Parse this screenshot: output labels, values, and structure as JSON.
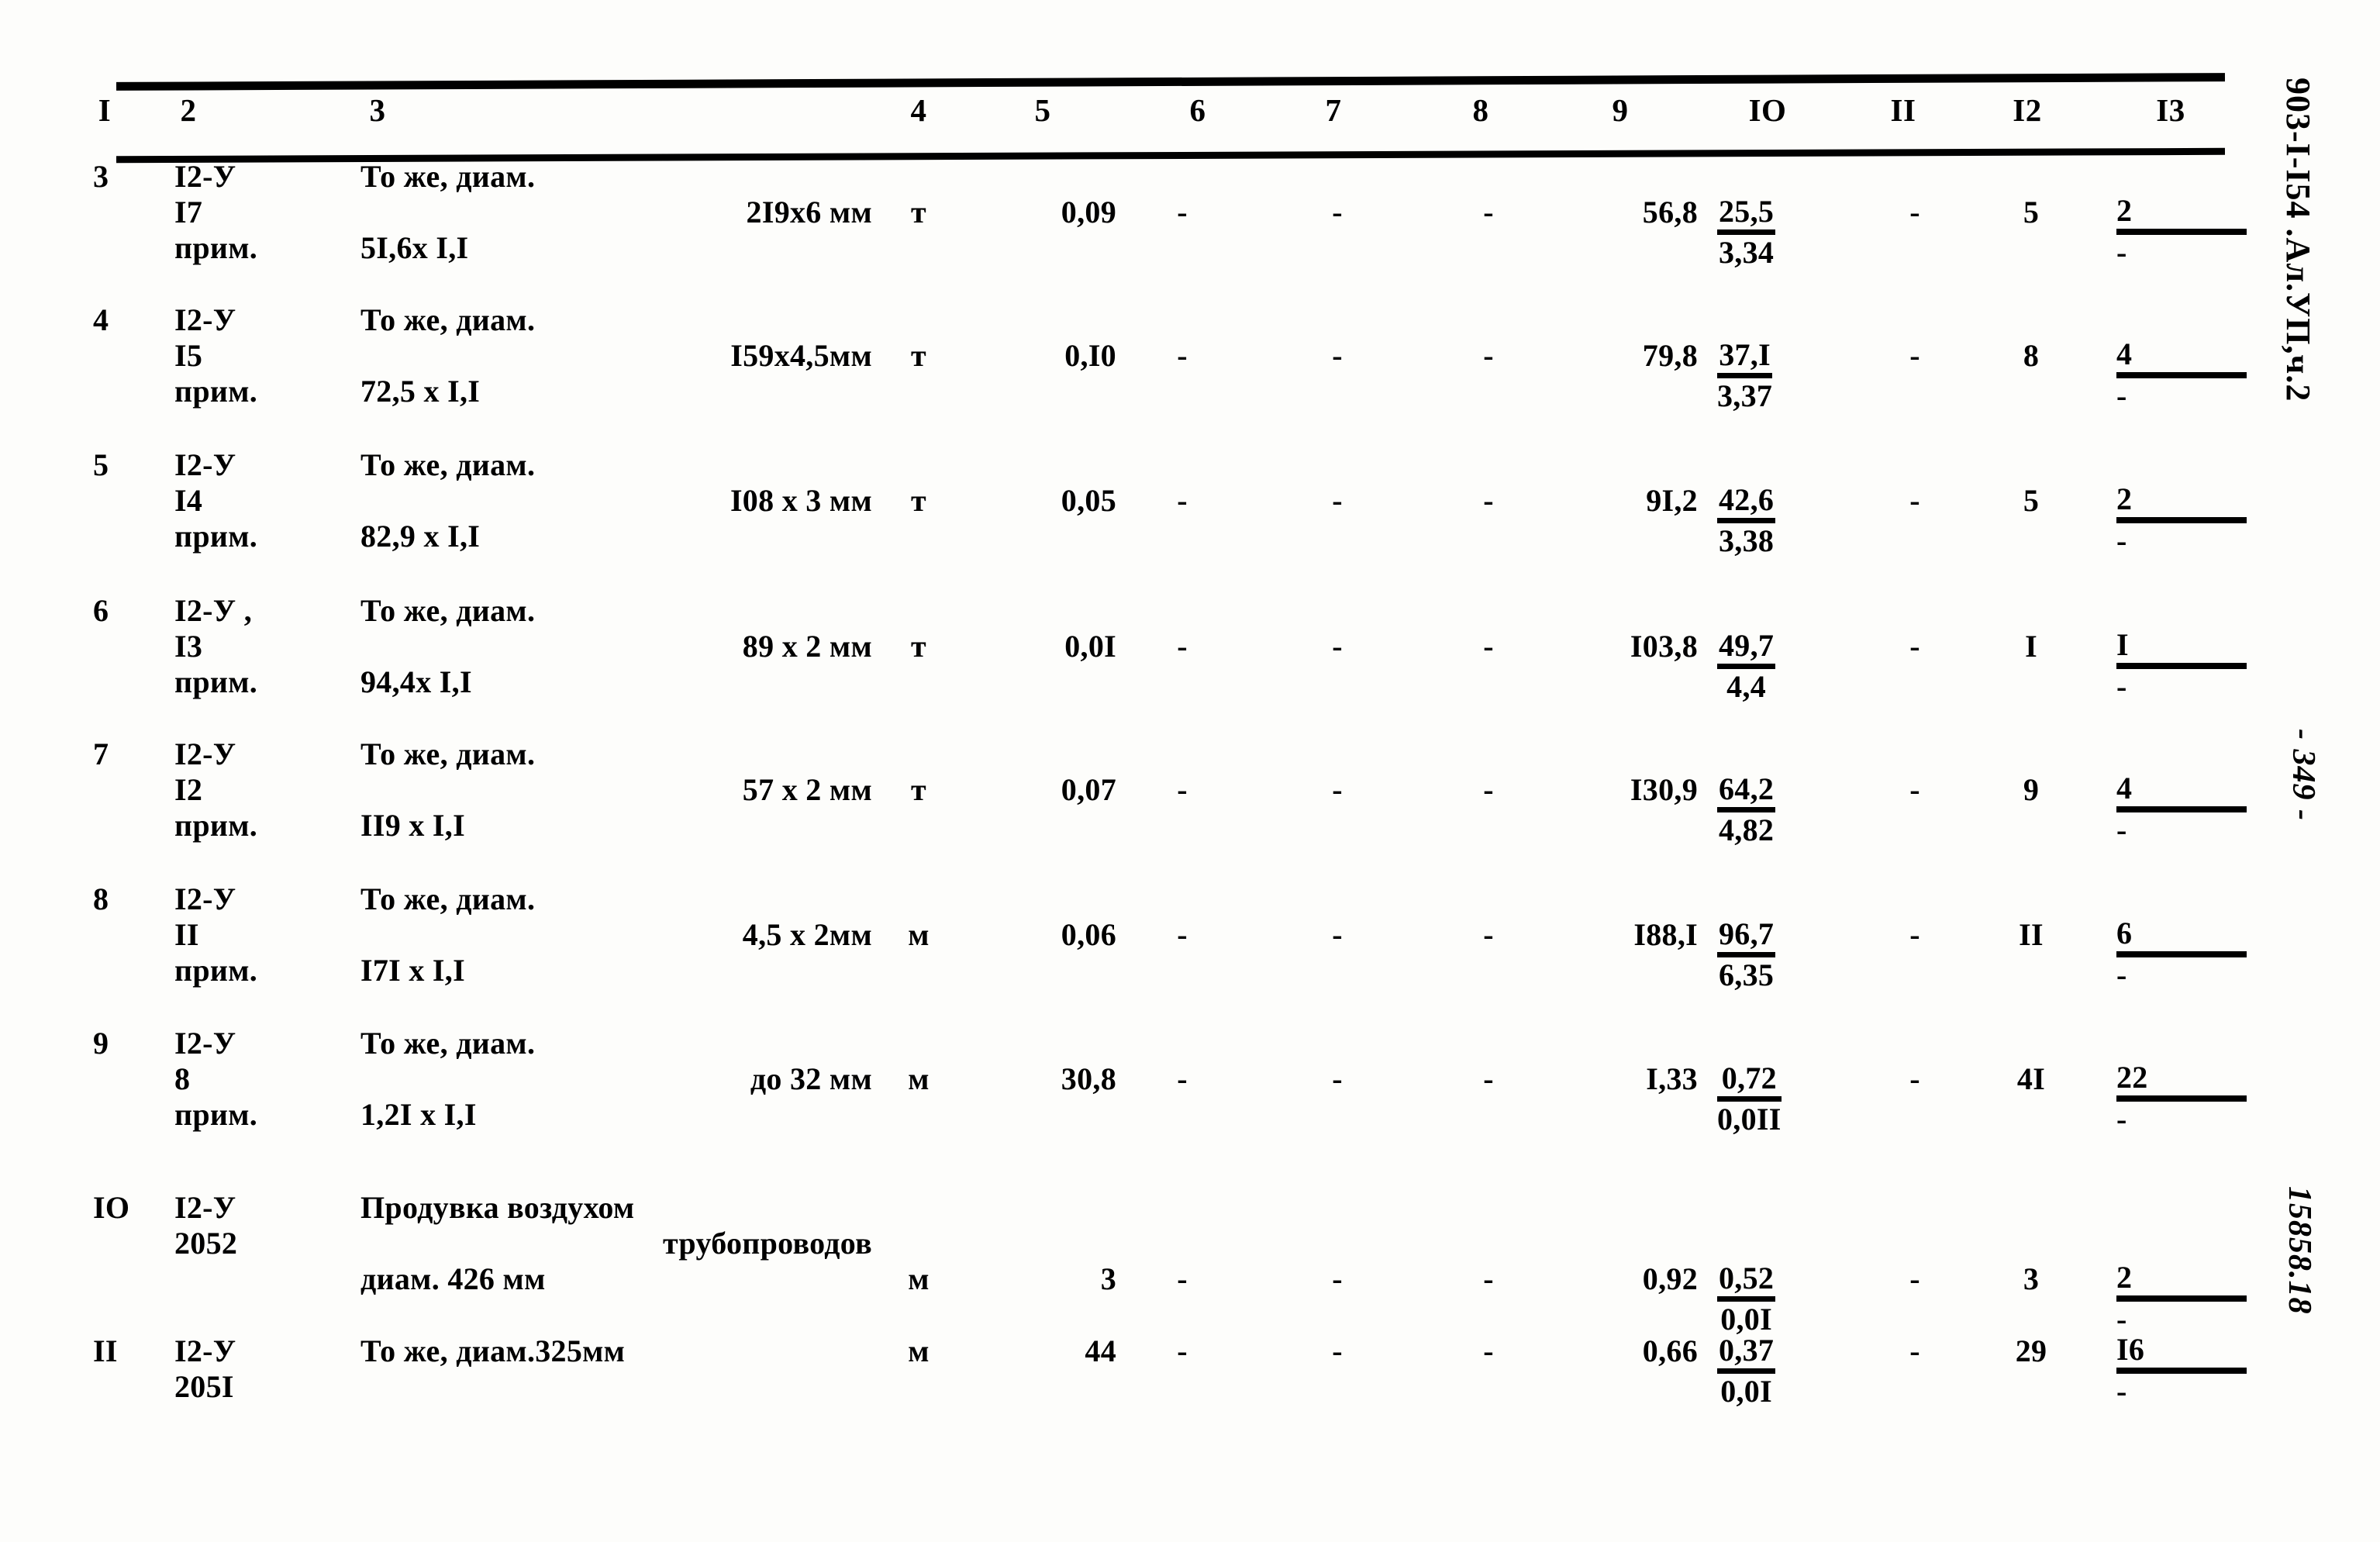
{
  "document": {
    "doc_code": "903-I-I54 .Ал.УП,ч.2",
    "page_marker": "- 349 -",
    "order_number": "15858.18"
  },
  "table": {
    "column_headers": [
      "I",
      "2",
      "3",
      "4",
      "5",
      "6",
      "7",
      "8",
      "9",
      "IO",
      "II",
      "I2",
      "I3"
    ],
    "rows": [
      {
        "no": "3",
        "code_line1": "I2-У",
        "code_line2": "I7",
        "code_line3": "прим.",
        "desc_line1": "То же, диам.",
        "desc_line2": "2I9x6 мм",
        "desc_line3": "5I,6x I,I",
        "unit": "т",
        "qty": "0,09",
        "c6": "-",
        "c7": "-",
        "c8": "-",
        "c9": "56,8",
        "c10_num": "25,5",
        "c10_den": "3,34",
        "c11": "-",
        "c12": "5",
        "c13_num": "2",
        "c13_den": "-"
      },
      {
        "no": "4",
        "code_line1": "I2-У",
        "code_line2": "I5",
        "code_line3": "прим.",
        "desc_line1": "То же, диам.",
        "desc_line2": "I59x4,5мм",
        "desc_line3": "72,5 x I,I",
        "unit": "т",
        "qty": "0,I0",
        "c6": "-",
        "c7": "-",
        "c8": "-",
        "c9": "79,8",
        "c10_num": "37,I",
        "c10_den": "3,37",
        "c11": "-",
        "c12": "8",
        "c13_num": "4",
        "c13_den": "-"
      },
      {
        "no": "5",
        "code_line1": "I2-У",
        "code_line2": "I4",
        "code_line3": "прим.",
        "desc_line1": "То же, диам.",
        "desc_line2": "I08 x 3 мм",
        "desc_line3": "82,9 x I,I",
        "unit": "т",
        "qty": "0,05",
        "c6": "-",
        "c7": "-",
        "c8": "-",
        "c9": "9I,2",
        "c10_num": "42,6",
        "c10_den": "3,38",
        "c11": "-",
        "c12": "5",
        "c13_num": "2",
        "c13_den": "-"
      },
      {
        "no": "6",
        "code_line1": "I2-У ,",
        "code_line2": "I3",
        "code_line3": "прим.",
        "desc_line1": "То же, диам.",
        "desc_line2": "89 x 2 мм",
        "desc_line3": "94,4x I,I",
        "unit": "т",
        "qty": "0,0I",
        "c6": "-",
        "c7": "-",
        "c8": "-",
        "c9": "I03,8",
        "c10_num": "49,7",
        "c10_den": "4,4",
        "c11": "-",
        "c12": "I",
        "c13_num": "I",
        "c13_den": "-"
      },
      {
        "no": "7",
        "code_line1": "I2-У",
        "code_line2": "I2",
        "code_line3": "прим.",
        "desc_line1": "То же, диам.",
        "desc_line2": "57 x 2 мм",
        "desc_line3": "II9 x I,I",
        "unit": "т",
        "qty": "0,07",
        "c6": "-",
        "c7": "-",
        "c8": "-",
        "c9": "I30,9",
        "c10_num": "64,2",
        "c10_den": "4,82",
        "c11": "-",
        "c12": "9",
        "c13_num": "4",
        "c13_den": "-"
      },
      {
        "no": "8",
        "code_line1": "I2-У",
        "code_line2": "II",
        "code_line3": "прим.",
        "desc_line1": "То же, диам.",
        "desc_line2": "4,5 x 2мм",
        "desc_line3": "I7I x I,I",
        "unit": "м",
        "qty": "0,06",
        "c6": "-",
        "c7": "-",
        "c8": "-",
        "c9": "I88,I",
        "c10_num": "96,7",
        "c10_den": "6,35",
        "c11": "-",
        "c12": "II",
        "c13_num": "6",
        "c13_den": "-"
      },
      {
        "no": "9",
        "code_line1": "I2-У",
        "code_line2": "8",
        "code_line3": "прим.",
        "desc_line1": "То же, диам.",
        "desc_line2": "до 32 мм",
        "desc_line3": "1,2I x I,I",
        "unit": "м",
        "qty": "30,8",
        "c6": "-",
        "c7": "-",
        "c8": "-",
        "c9": "I,33",
        "c10_num": "0,72",
        "c10_den": "0,0II",
        "c11": "-",
        "c12": "4I",
        "c13_num": "22",
        "c13_den": "-"
      },
      {
        "no": "IO",
        "code_line1": "I2-У",
        "code_line2": "2052",
        "code_line3": "",
        "desc_line1": "Продувка воздухом",
        "desc_line2": "трубопроводов",
        "desc_line3": "диам. 426 мм",
        "unit": "м",
        "qty": "3",
        "c6": "-",
        "c7": "-",
        "c8": "-",
        "c9": "0,92",
        "c10_num": "0,52",
        "c10_den": "0,0I",
        "c11": "-",
        "c12": "3",
        "c13_num": "2",
        "c13_den": "-"
      },
      {
        "no": "II",
        "code_line1": "I2-У",
        "code_line2": "205I",
        "code_line3": "",
        "desc_line1": "То же, диам.325мм",
        "desc_line2": "",
        "desc_line3": "",
        "unit": "м",
        "qty": "44",
        "c6": "-",
        "c7": "-",
        "c8": "-",
        "c9": "0,66",
        "c10_num": "0,37",
        "c10_den": "0,0I",
        "c11": "-",
        "c12": "29",
        "c13_num": "I6",
        "c13_den": "-"
      }
    ]
  }
}
